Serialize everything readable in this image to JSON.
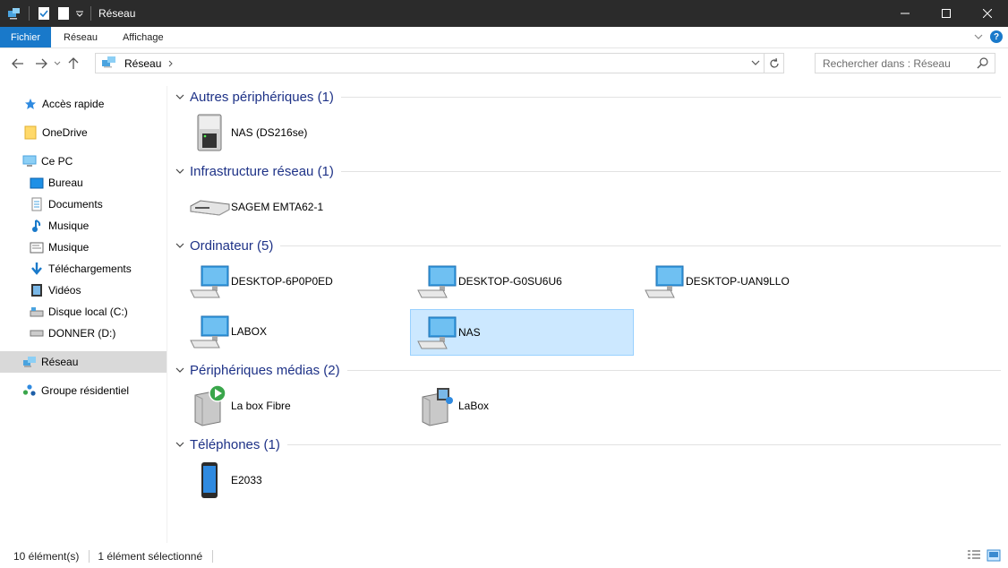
{
  "window": {
    "title": "Réseau"
  },
  "ribbon": {
    "tabs": [
      "Fichier",
      "Réseau",
      "Affichage"
    ],
    "help": "?"
  },
  "address": {
    "path": "Réseau"
  },
  "search": {
    "placeholder": "Rechercher dans : Réseau"
  },
  "sidebar": {
    "items": [
      {
        "label": "Accès rapide",
        "icon": "star-icon"
      },
      {
        "label": "OneDrive",
        "icon": "onedrive-folder-icon"
      },
      {
        "label": "Ce PC",
        "icon": "computer-icon"
      },
      {
        "label": "Bureau",
        "icon": "desktop-icon"
      },
      {
        "label": "Documents",
        "icon": "documents-icon"
      },
      {
        "label": "Musique",
        "icon": "music-icon"
      },
      {
        "label": "Musique",
        "icon": "music-folder-icon"
      },
      {
        "label": "Téléchargements",
        "icon": "download-icon"
      },
      {
        "label": "Vidéos",
        "icon": "video-icon"
      },
      {
        "label": "Disque local (C:)",
        "icon": "drive-c-icon"
      },
      {
        "label": "DONNER (D:)",
        "icon": "drive-d-icon"
      },
      {
        "label": "Réseau",
        "icon": "network-icon"
      },
      {
        "label": "Groupe résidentiel",
        "icon": "homegroup-icon"
      }
    ]
  },
  "groups": [
    {
      "title": "Autres périphériques (1)",
      "items": [
        {
          "label": "NAS (DS216se)",
          "icon": "nas-device-icon"
        }
      ]
    },
    {
      "title": "Infrastructure réseau (1)",
      "items": [
        {
          "label": "SAGEM EMTA62-1",
          "icon": "router-icon"
        }
      ]
    },
    {
      "title": "Ordinateur (5)",
      "items": [
        {
          "label": "DESKTOP-6P0P0ED",
          "icon": "computer-icon"
        },
        {
          "label": "DESKTOP-G0SU6U6",
          "icon": "computer-icon"
        },
        {
          "label": "DESKTOP-UAN9LLO",
          "icon": "computer-icon"
        },
        {
          "label": "LABOX",
          "icon": "computer-icon"
        },
        {
          "label": "NAS",
          "icon": "computer-icon"
        }
      ]
    },
    {
      "title": "Périphériques médias (2)",
      "items": [
        {
          "label": "La box Fibre",
          "icon": "media-player-icon"
        },
        {
          "label": "LaBox",
          "icon": "media-server-icon"
        }
      ]
    },
    {
      "title": "Téléphones (1)",
      "items": [
        {
          "label": "E2033",
          "icon": "phone-icon"
        }
      ]
    }
  ],
  "status": {
    "count": "10 élément(s)",
    "selection": "1 élément sélectionné"
  },
  "colors": {
    "accent": "#1979ca",
    "group_title": "#1e3287",
    "selection": "#cce8ff",
    "titlebar": "#2b2b2b"
  }
}
